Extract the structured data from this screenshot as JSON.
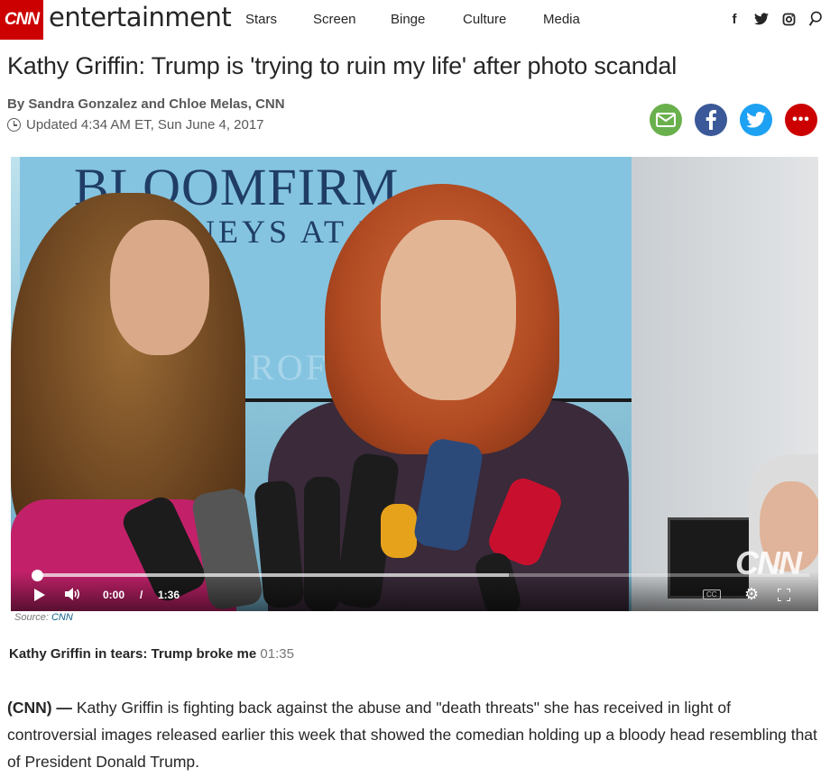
{
  "brand": {
    "logo": "CNN",
    "section": "entertainment",
    "logo_color": "#cc0000"
  },
  "nav": {
    "links": [
      "Stars",
      "Screen",
      "Binge",
      "Culture",
      "Media"
    ]
  },
  "nav_social": {
    "facebook": "f",
    "twitter": "t",
    "instagram": "o",
    "search": "search"
  },
  "article": {
    "headline": "Kathy Griffin: Trump is 'trying to ruin my life' after photo scandal",
    "byline": "By Sandra Gonzalez and Chloe Melas, CNN",
    "updated": "Updated 4:34 AM ET, Sun June 4, 2017",
    "source_prefix": "Source:",
    "source_name": "CNN",
    "related_title": "Kathy Griffin in tears: Trump broke me",
    "related_duration": "01:35",
    "body_lead": "(CNN) —",
    "body": "Kathy Griffin is fighting back against the abuse and \"death threats\" she has received in light of controversial images released earlier this week that showed the comedian holding up a bloody head resembling that of President Donald Trump."
  },
  "share": {
    "email_color": "#6ab04c",
    "facebook_color": "#3b5998",
    "twitter_color": "#1da1f2",
    "more_color": "#cc0000",
    "more_label": "•••"
  },
  "video": {
    "current_time": "0:00",
    "separator": "/",
    "duration": "1:36",
    "cc_label": "CC",
    "watermark": "CNN",
    "buffered_fraction": 0.61,
    "played_fraction": 0.0,
    "backdrop_line1": "BLOOMFIRM",
    "backdrop_line2": "NEYS AT LA",
    "backdrop_line3": "PROF"
  }
}
